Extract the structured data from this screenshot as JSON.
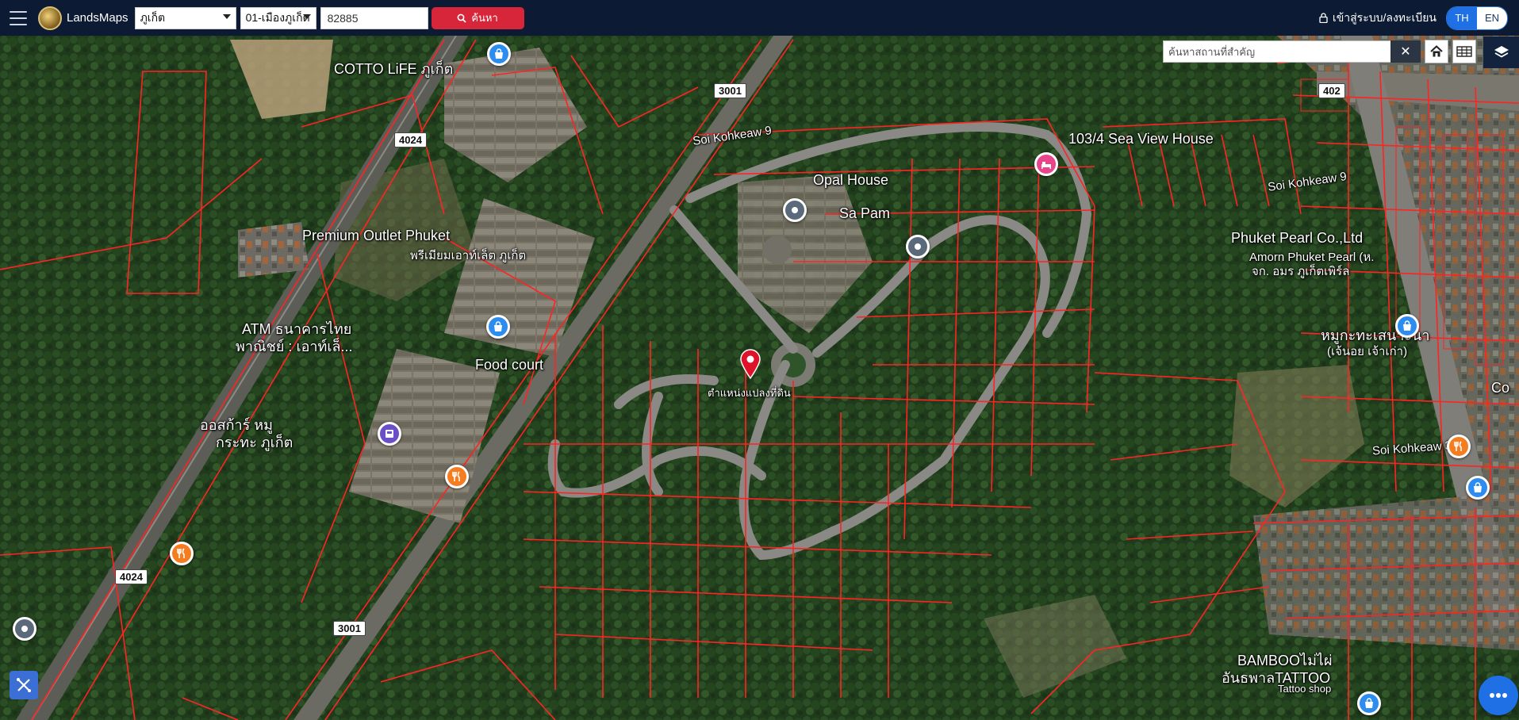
{
  "header": {
    "brand": "LandsMaps",
    "province": "ภูเก็ต",
    "district": "01-เมืองภูเก็ต",
    "parcel_number": "82885",
    "search_label": "ค้นหา",
    "login_label": "เข้าสู่ระบบ/ลงทะเบียน",
    "lang_th": "TH",
    "lang_en": "EN"
  },
  "map_controls": {
    "place_search_placeholder": "ค้นหาสถานที่สำคัญ",
    "clear_symbol": "✕"
  },
  "road_shields": [
    "4024",
    "3001",
    "4024",
    "3001",
    "402"
  ],
  "labels": {
    "cotto": "COTTO LiFE ภูเก็ต",
    "soi_kohkeaw_9_left": "Soi Kohkeaw 9",
    "opal_house": "Opal House",
    "sa_pam": "Sa Pam",
    "sea_view_house": "103/4 Sea View House",
    "soi_kohkeaw_9_right": "Soi Kohkeaw 9",
    "premium_outlet": "Premium Outlet Phuket",
    "premium_outlet_th": "พรีเมียมเอาท์เล็ต ภูเก็ต",
    "phuket_pearl": "Phuket Pearl Co.,Ltd",
    "amorn_pearl": "Amorn Phuket Pearl (ห.",
    "amorn_pearl_2": "จก. อมร ภูเก็ตเพิร์ล",
    "atm_line1": "ATM ธนาคารไทย",
    "atm_line2": "พาณิชย์ : เอาท์เล็...",
    "food_court": "Food court",
    "marker_label": "ตำแหน่งแปลงที่ดิน",
    "restaurant_right_1": "หมูกะทะเสนาะนา",
    "restaurant_right_2": "(เจ้นอย เจ้าเก่า)",
    "orsot_line1": "ออสก้าร์ หมู",
    "orsot_line2": "กระทะ ภูเก็ต",
    "soi_kohkeaw_3": "Soi Kohkeaw 3",
    "bamboo_line1": "BAMBOOไม่ไผ่",
    "bamboo_line2": "อันธพาลTATTOO",
    "bamboo_line3": "Tattoo shop",
    "right_edge_letter": "Co"
  },
  "colors": {
    "parcel_line": "#ff2323",
    "marker": "#e0122a",
    "poi_blue": "#2d8cf0",
    "poi_orange": "#f57c1f",
    "poi_pink": "#e8458b",
    "poi_gray": "#5a6a7a",
    "poi_purple": "#6a4fc9"
  },
  "icons": [
    "menu-icon",
    "seal-logo-icon",
    "search-icon",
    "lock-icon",
    "home-icon",
    "grid-icon",
    "layers-icon",
    "tools-icon",
    "chat-icon",
    "location-pin-icon"
  ]
}
